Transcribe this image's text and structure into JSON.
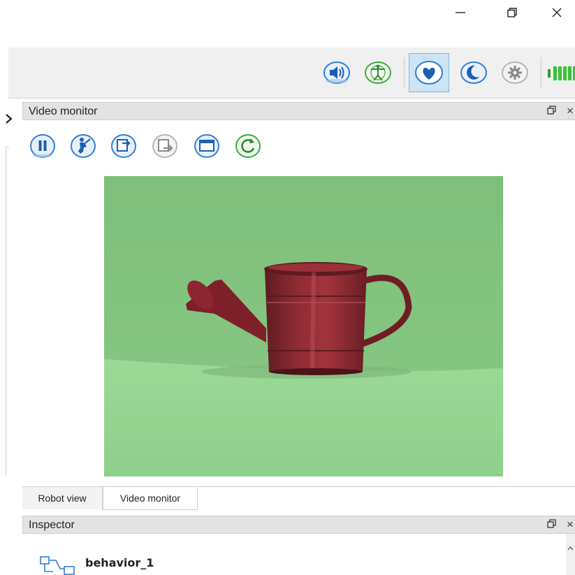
{
  "window": {
    "minimize_icon": "minimize-icon",
    "restore_icon": "restore-icon",
    "close_icon": "close-icon"
  },
  "toolbar": {
    "icons": [
      "speaker-icon",
      "vitruvian-man-icon",
      "heart-icon",
      "moon-icon",
      "gear-icon",
      "battery-icon"
    ],
    "active_icon": "heart-icon",
    "battery_color": "#3cc23c"
  },
  "video_panel": {
    "title": "Video monitor",
    "buttons": [
      "pause-icon",
      "robot-pose-icon",
      "import-icon",
      "export-icon",
      "window-icon",
      "refresh-icon"
    ],
    "image": "watering-can-photo"
  },
  "tabs": [
    {
      "label": "Robot view",
      "active": false
    },
    {
      "label": "Video monitor",
      "active": true
    }
  ],
  "inspector": {
    "title": "Inspector",
    "item_label": "behavior_1"
  },
  "colors": {
    "accent": "#2f7fd6",
    "active_bg": "#cde4f7",
    "screen_green": "#86c986"
  }
}
